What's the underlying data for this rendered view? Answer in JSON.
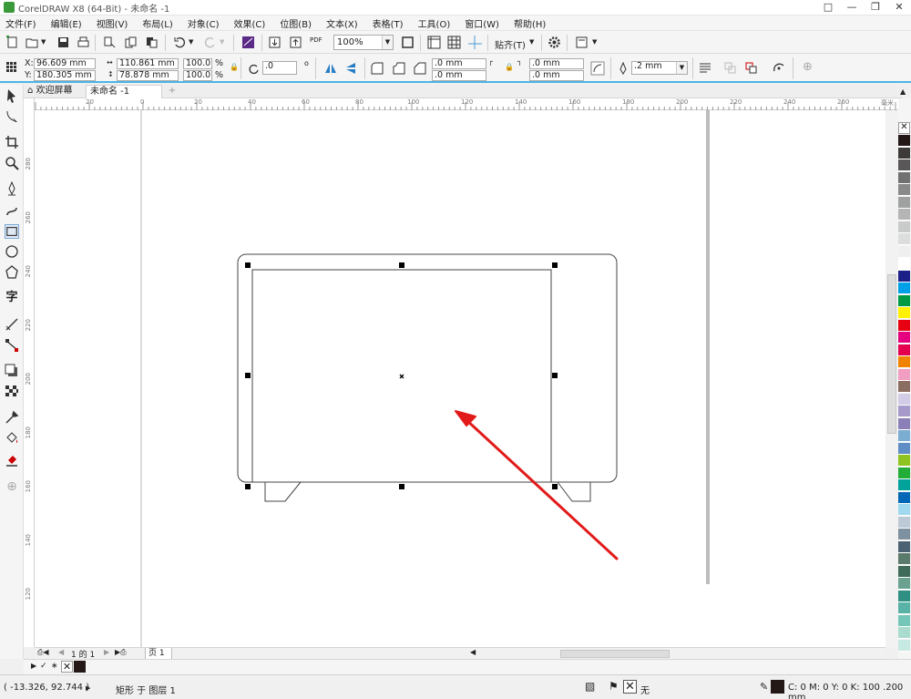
{
  "window": {
    "title": "CorelDRAW X8 (64-Bit) - 未命名 -1"
  },
  "menu": [
    "文件(F)",
    "编辑(E)",
    "视图(V)",
    "布局(L)",
    "对象(C)",
    "效果(C)",
    "位图(B)",
    "文本(X)",
    "表格(T)",
    "工具(O)",
    "窗口(W)",
    "帮助(H)"
  ],
  "toolbar": {
    "zoom": "100%",
    "snap_label": "贴齐(T)",
    "pdf_label": "PDF"
  },
  "propbar": {
    "x_label": "X:",
    "x": "96.609 mm",
    "y_label": "Y:",
    "y": "180.305 mm",
    "width": "110.861 mm",
    "height": "78.878 mm",
    "scale_w": "100.0",
    "scale_h": "100.0",
    "percent": "%",
    "rotation": ".0",
    "degree": "o",
    "corner_1": ".0 mm",
    "corner_2": ".0 mm",
    "corner_3": ".0 mm",
    "corner_4": ".0 mm",
    "outline_width": ".2 mm"
  },
  "tabs": {
    "welcome": "欢迎屏幕",
    "document": "未命名 -1",
    "add": "+"
  },
  "rulers": {
    "horizontal": [
      "20",
      "0",
      "20",
      "40",
      "60",
      "80",
      "100",
      "120",
      "140",
      "160",
      "180",
      "200",
      "220",
      "240",
      "260"
    ],
    "unit": "毫米",
    "vertical": [
      "280",
      "260",
      "240",
      "220",
      "200",
      "180",
      "160",
      "140",
      "120",
      "100"
    ]
  },
  "pagenav": {
    "page_of": "1 的 1",
    "page_tab": "页 1"
  },
  "status": {
    "coords": "( -13.326, 92.744 )",
    "object": "矩形 于 图层 1",
    "fill_none": "无",
    "outline_info": "C: 0 M: 0 Y: 0 K: 100  .200 mm"
  },
  "palette_colors": [
    "#231815",
    "#3e3a39",
    "#595757",
    "#727171",
    "#898989",
    "#9fa0a0",
    "#b5b5b6",
    "#c9caca",
    "#dcdddd",
    "#efefef",
    "#ffffff",
    "#1d2088",
    "#00a0e9",
    "#009944",
    "#fff100",
    "#e60012",
    "#e4007f",
    "#e5004f",
    "#f08300",
    "#f19ec2",
    "#8c6d62",
    "#d3cce6",
    "#a59aca",
    "#8c7fb8",
    "#7bacd1",
    "#5f8dc6",
    "#8fc31f",
    "#22ac38",
    "#00a29a",
    "#0068b7",
    "#a0d8ef",
    "#bcc9d6",
    "#7d91a0",
    "#4c6272",
    "#5a7a6c",
    "#3f6b5a",
    "#6aa190",
    "#2f8f83",
    "#58b2a6",
    "#74c7b8",
    "#a9dccf",
    "#c7e9e2"
  ]
}
